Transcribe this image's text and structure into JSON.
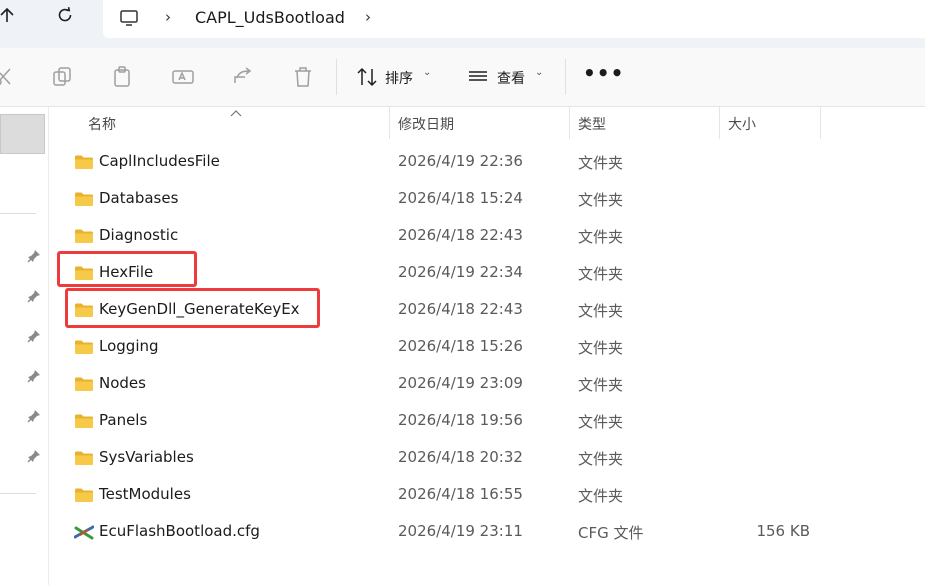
{
  "address": {
    "crumb": "CAPL_UdsBootload",
    "sep": "›"
  },
  "toolbar": {
    "sort_label": "排序",
    "view_label": "查看",
    "more_label": "•••",
    "chevron": "⌄"
  },
  "columns": {
    "name": "名称",
    "date": "修改日期",
    "type": "类型",
    "size": "大小"
  },
  "rows": [
    {
      "name": "CaplIncludesFile",
      "date": "2026/4/19 22:36",
      "type": "文件夹",
      "size": "",
      "icon": "folder-icon"
    },
    {
      "name": "Databases",
      "date": "2026/4/18 15:24",
      "type": "文件夹",
      "size": "",
      "icon": "folder-icon"
    },
    {
      "name": "Diagnostic",
      "date": "2026/4/18 22:43",
      "type": "文件夹",
      "size": "",
      "icon": "folder-icon"
    },
    {
      "name": "HexFile",
      "date": "2026/4/19 22:34",
      "type": "文件夹",
      "size": "",
      "icon": "folder-icon"
    },
    {
      "name": "KeyGenDll_GenerateKeyEx",
      "date": "2026/4/18 22:43",
      "type": "文件夹",
      "size": "",
      "icon": "folder-icon"
    },
    {
      "name": "Logging",
      "date": "2026/4/18 15:26",
      "type": "文件夹",
      "size": "",
      "icon": "folder-icon"
    },
    {
      "name": "Nodes",
      "date": "2026/4/19 23:09",
      "type": "文件夹",
      "size": "",
      "icon": "folder-icon"
    },
    {
      "name": "Panels",
      "date": "2026/4/18 19:56",
      "type": "文件夹",
      "size": "",
      "icon": "folder-icon"
    },
    {
      "name": "SysVariables",
      "date": "2026/4/18 20:32",
      "type": "文件夹",
      "size": "",
      "icon": "folder-icon"
    },
    {
      "name": "TestModules",
      "date": "2026/4/18 16:55",
      "type": "文件夹",
      "size": "",
      "icon": "folder-icon"
    },
    {
      "name": "EcuFlashBootload.cfg",
      "date": "2026/4/19 23:11",
      "type": "CFG 文件",
      "size": "156 KB",
      "icon": "canoe-config-icon"
    }
  ],
  "colors": {
    "highlight": "#ee3b3b",
    "folder": "#f7c948",
    "addressbar": "#eff3f8"
  }
}
